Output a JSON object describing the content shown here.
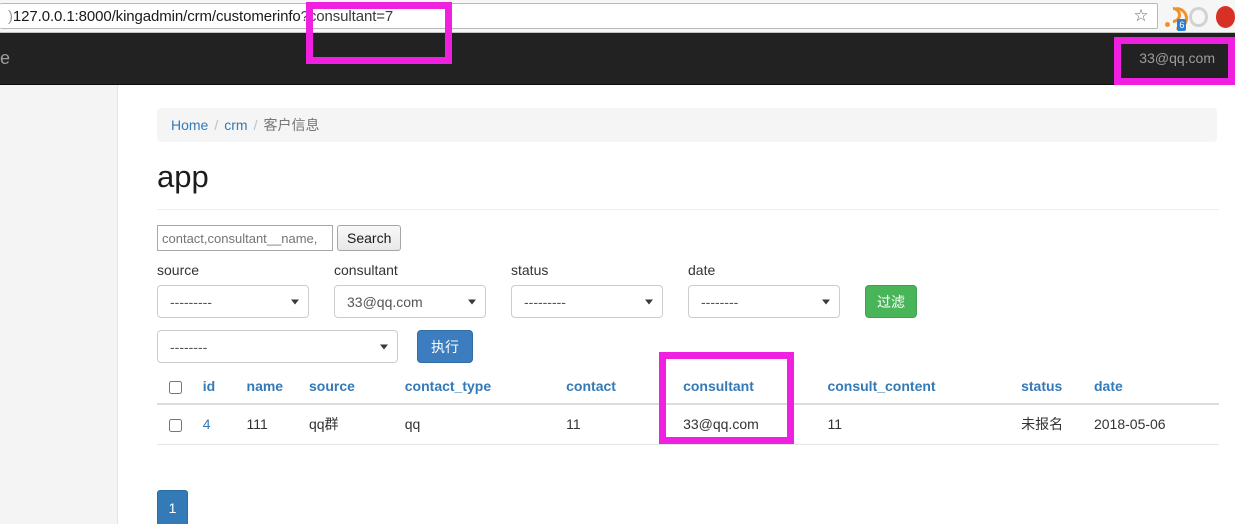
{
  "browser": {
    "url_base": "127.0.0.1:8000/kingadmin/crm/customerinfo",
    "url_query": "?consultant=7",
    "protocol_mark": ")",
    "star_icon": "☆",
    "rss_badge": "6"
  },
  "navbar": {
    "brand_fragment": "e",
    "user": "33@qq.com"
  },
  "breadcrumb": {
    "home": "Home",
    "app": "crm",
    "current": "客户信息",
    "sep": "/"
  },
  "page": {
    "title": "app"
  },
  "search": {
    "placeholder": "contact,consultant__name,",
    "value": "",
    "button_label": "Search"
  },
  "filters": [
    {
      "label": "source",
      "value": "---------"
    },
    {
      "label": "consultant",
      "value": "33@qq.com"
    },
    {
      "label": "status",
      "value": "---------"
    },
    {
      "label": "date",
      "value": "--------"
    }
  ],
  "filter_button": "过滤",
  "action": {
    "select_value": "--------",
    "button_label": "执行"
  },
  "table": {
    "columns": [
      "id",
      "name",
      "source",
      "contact_type",
      "contact",
      "consultant",
      "consult_content",
      "status",
      "date"
    ],
    "rows": [
      {
        "id": "4",
        "name": "111",
        "source": "qq群",
        "contact_type": "qq",
        "contact": "11",
        "consultant": "33@qq.com",
        "consult_content": "11",
        "status": "未报名",
        "date": "2018-05-06"
      }
    ]
  },
  "pagination": {
    "pages": [
      "1"
    ]
  },
  "colors": {
    "accent_link": "#337ab7",
    "filter_green": "#49b559",
    "action_blue": "#3b7dbf",
    "annotation_magenta": "#f020e0",
    "navbar_dark": "#222222"
  }
}
